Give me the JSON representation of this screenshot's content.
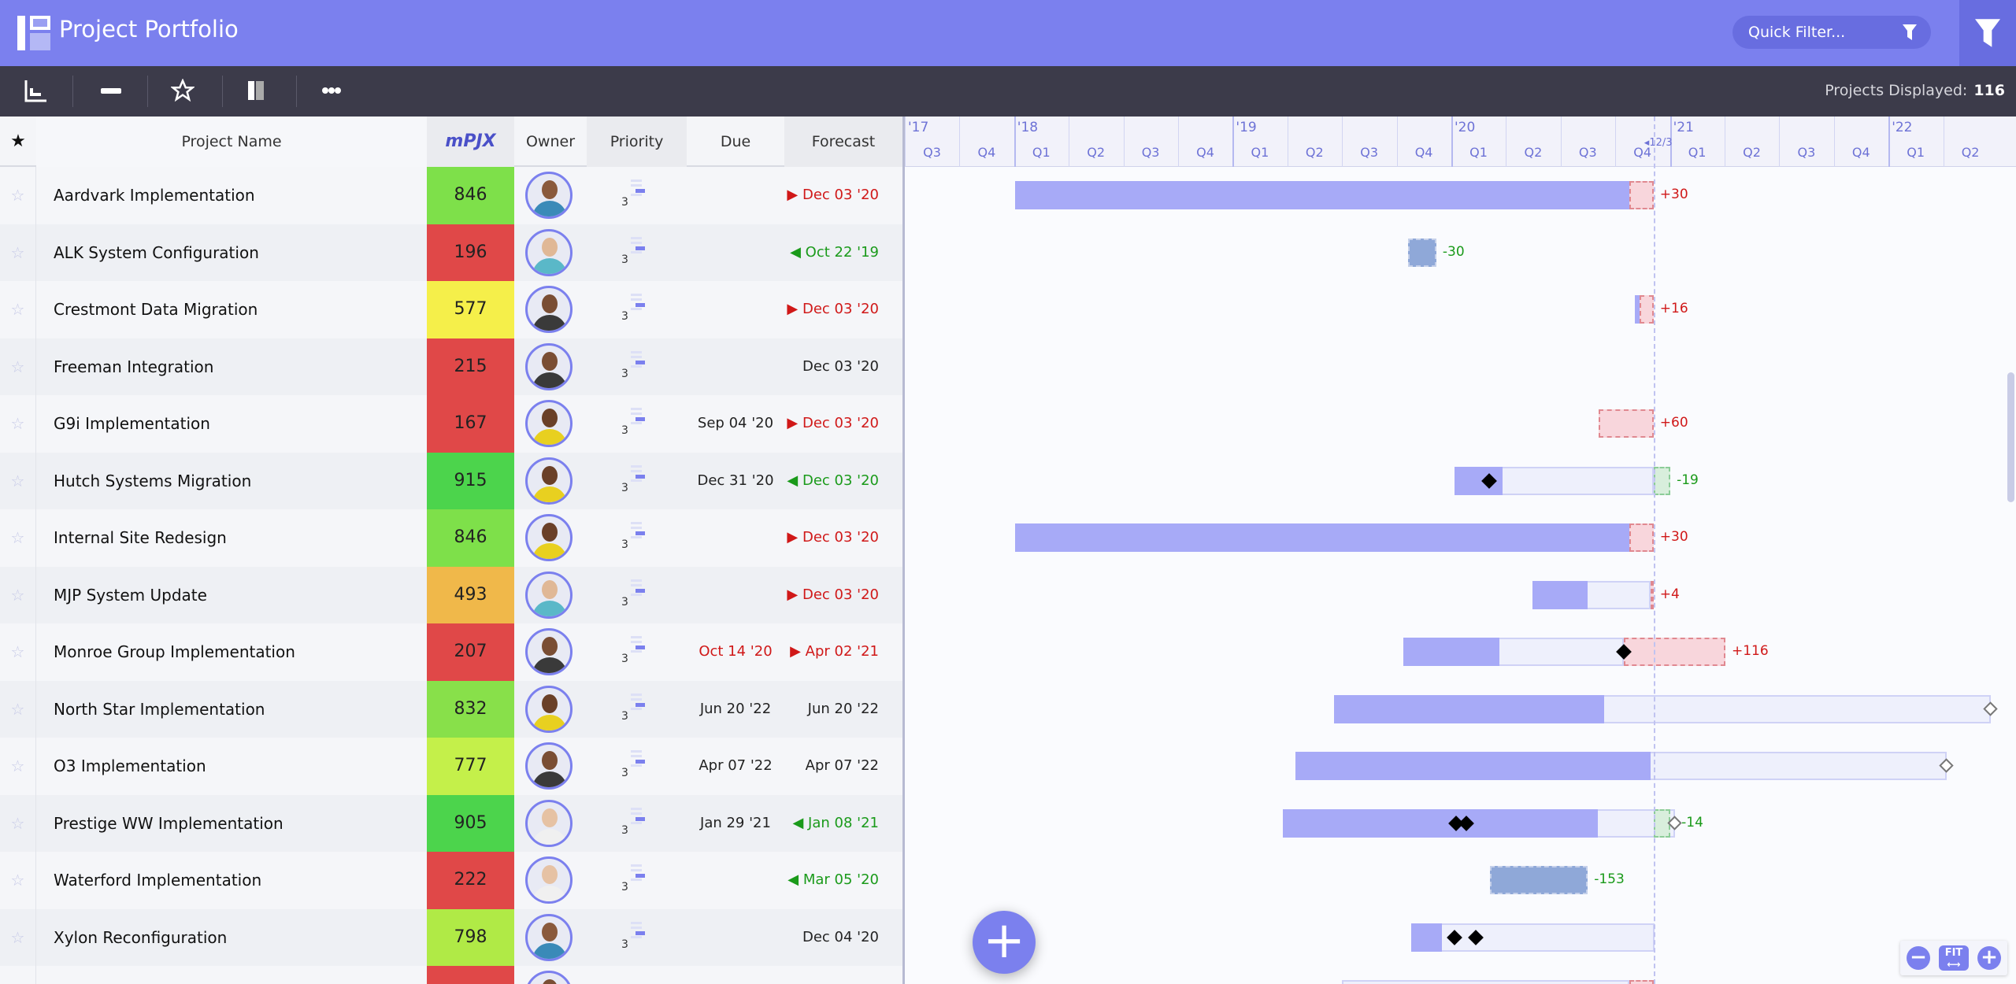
{
  "app": {
    "title": "Project Portfolio",
    "quick_filter_placeholder": "Quick Filter...",
    "accent": "#7b80ee"
  },
  "toolbar": {
    "icons": [
      "gantt-chart-icon",
      "collapse-icon",
      "favorite-star-icon",
      "column-layout-icon",
      "more-icon"
    ],
    "projects_displayed_label": "Projects Displayed:",
    "projects_displayed_value": "116"
  },
  "columns": {
    "star": "★",
    "name": "Project Name",
    "score": "mPJX",
    "owner": "Owner",
    "priority": "Priority",
    "due": "Due",
    "forecast": "Forecast"
  },
  "timeline": {
    "years": [
      "'17",
      "'18",
      "'19",
      "'20",
      "'21",
      "'22"
    ],
    "quarters": [
      "Q3",
      "Q4",
      "Q1",
      "Q2",
      "Q3",
      "Q4",
      "Q1",
      "Q2",
      "Q3",
      "Q4",
      "Q1",
      "Q2",
      "Q3",
      "Q4",
      "Q1",
      "Q2",
      "Q3",
      "Q4",
      "Q1",
      "Q2"
    ],
    "start": "2017-07-01",
    "today_label": "12/3",
    "today": "2020-12-03"
  },
  "rows": [
    {
      "name": "Aardvark Implementation",
      "score": "846",
      "score_color": "#7ee04a",
      "owner": "m1",
      "priority": "3",
      "due": "",
      "forecast": "Dec 03 '20",
      "forecast_status": "late",
      "gantt": {
        "outline": null,
        "fill": [
          "2018-01-01",
          "2020-10-24"
        ],
        "variance": [
          "2020-10-24",
          "2020-12-03"
        ],
        "variance_type": "over",
        "label": "+30",
        "milestones": [],
        "open_milestone": null
      }
    },
    {
      "name": "ALK System Configuration",
      "score": "196",
      "score_color": "#e04848",
      "owner": "w1",
      "priority": "3",
      "due": "",
      "forecast": "Oct 22 '19",
      "forecast_status": "early",
      "gantt": {
        "done": [
          "2019-10-20",
          "2019-12-06"
        ],
        "label": "-30",
        "variance_type": "under",
        "milestones": []
      }
    },
    {
      "name": "Crestmont Data Migration",
      "score": "577",
      "score_color": "#f5ef4a",
      "owner": "m2",
      "priority": "3",
      "due": "",
      "forecast": "Dec 03 '20",
      "forecast_status": "late",
      "gantt": {
        "fill": [
          "2020-11-02",
          "2020-11-10"
        ],
        "variance": [
          "2020-11-10",
          "2020-12-03"
        ],
        "variance_type": "over",
        "label": "+16",
        "milestones": []
      }
    },
    {
      "name": "Freeman Integration",
      "score": "215",
      "score_color": "#e04848",
      "owner": "m2",
      "priority": "3",
      "due": "",
      "forecast": "Dec 03 '20",
      "forecast_status": "none",
      "gantt": {
        "milestones": []
      }
    },
    {
      "name": "G9i Implementation",
      "score": "167",
      "score_color": "#e04848",
      "owner": "w2",
      "priority": "3",
      "due": "Sep 04 '20",
      "forecast": "Dec 03 '20",
      "forecast_status": "late",
      "gantt": {
        "variance": [
          "2020-09-02",
          "2020-12-03"
        ],
        "variance_type": "over",
        "label": "+60",
        "milestones": []
      }
    },
    {
      "name": "Hutch Systems Migration",
      "score": "915",
      "score_color": "#4cd44c",
      "owner": "w2",
      "priority": "3",
      "due": "Dec 31 '20",
      "forecast": "Dec 03 '20",
      "forecast_status": "early",
      "gantt": {
        "outline": [
          "2020-01-05",
          "2020-12-03"
        ],
        "fill": [
          "2020-01-05",
          "2020-03-25"
        ],
        "variance": [
          "2020-12-03",
          "2020-12-31"
        ],
        "variance_type": "under",
        "label": "-19",
        "milestones": [
          "2020-03-03"
        ]
      }
    },
    {
      "name": "Internal Site Redesign",
      "score": "846",
      "score_color": "#7ee04a",
      "owner": "w2",
      "priority": "3",
      "due": "",
      "forecast": "Dec 03 '20",
      "forecast_status": "late",
      "gantt": {
        "fill": [
          "2018-01-01",
          "2020-10-24"
        ],
        "variance": [
          "2020-10-24",
          "2020-12-03"
        ],
        "variance_type": "over",
        "label": "+30",
        "milestones": []
      }
    },
    {
      "name": "MJP System Update",
      "score": "493",
      "score_color": "#f0b84a",
      "owner": "w1",
      "priority": "3",
      "due": "",
      "forecast": "Dec 03 '20",
      "forecast_status": "late",
      "gantt": {
        "outline": [
          "2020-05-15",
          "2020-11-28"
        ],
        "fill": [
          "2020-05-15",
          "2020-08-15"
        ],
        "variance": [
          "2020-11-28",
          "2020-12-03"
        ],
        "variance_type": "over",
        "label": "+4",
        "milestones": []
      }
    },
    {
      "name": "Monroe Group Implementation",
      "score": "207",
      "score_color": "#e04848",
      "owner": "m2",
      "priority": "3",
      "due": "Oct 14 '20",
      "due_status": "late",
      "forecast": "Apr 02 '21",
      "forecast_status": "late",
      "gantt": {
        "outline": [
          "2019-10-12",
          "2020-10-14"
        ],
        "fill": [
          "2019-10-12",
          "2020-03-20"
        ],
        "variance": [
          "2020-10-14",
          "2021-04-02"
        ],
        "variance_type": "over",
        "label": "+116",
        "milestones": [
          "2020-10-14"
        ]
      }
    },
    {
      "name": "North Star Implementation",
      "score": "832",
      "score_color": "#88e04a",
      "owner": "w2",
      "priority": "3",
      "due": "Jun 20 '22",
      "forecast": "Jun 20 '22",
      "forecast_status": "none",
      "gantt": {
        "outline": [
          "2019-06-18",
          "2022-06-20"
        ],
        "fill": [
          "2019-06-18",
          "2020-09-12"
        ],
        "milestones": [],
        "open_milestone": "2022-06-20"
      }
    },
    {
      "name": "O3 Implementation",
      "score": "777",
      "score_color": "#c4f04a",
      "owner": "m2",
      "priority": "3",
      "due": "Apr 07 '22",
      "forecast": "Apr 07 '22",
      "forecast_status": "none",
      "gantt": {
        "outline": [
          "2019-04-15",
          "2022-04-07"
        ],
        "fill": [
          "2019-04-15",
          "2020-11-28"
        ],
        "milestones": [],
        "open_milestone": "2022-04-07"
      }
    },
    {
      "name": "Prestige WW Implementation",
      "score": "905",
      "score_color": "#4cd44c",
      "owner": "w3",
      "priority": "3",
      "due": "Jan 29 '21",
      "forecast": "Jan 08 '21",
      "forecast_status": "early",
      "gantt": {
        "outline": [
          "2019-03-25",
          "2021-01-08"
        ],
        "fill": [
          "2019-03-25",
          "2020-09-01"
        ],
        "variance": [
          "2020-12-03",
          "2020-12-31"
        ],
        "variance_type": "under",
        "label": "-14",
        "milestones": [
          "2020-01-08",
          "2020-01-25"
        ],
        "open_milestone": "2021-01-08"
      }
    },
    {
      "name": "Waterford Implementation",
      "score": "222",
      "score_color": "#e04848",
      "owner": "w3",
      "priority": "3",
      "due": "",
      "forecast": "Mar 05 '20",
      "forecast_status": "early",
      "gantt": {
        "done": [
          "2020-03-05",
          "2020-08-15"
        ],
        "label": "-153",
        "variance_type": "under",
        "milestones": []
      }
    },
    {
      "name": "Xylon Reconfiguration",
      "score": "798",
      "score_color": "#b0ea46",
      "owner": "m1",
      "priority": "3",
      "due": "",
      "forecast": "Dec 04 '20",
      "forecast_status": "none",
      "gantt": {
        "outline": [
          "2019-10-25",
          "2020-12-04"
        ],
        "fill": [
          "2019-10-25",
          "2019-12-15"
        ],
        "milestones": [
          "2020-01-05",
          "2020-02-10"
        ]
      }
    },
    {
      "name": "",
      "score": "",
      "score_color": "#e04848",
      "owner": "m2",
      "priority": "",
      "due": "",
      "forecast": "",
      "forecast_status": "none",
      "gantt": {
        "outline": [
          "2019-07-01",
          "2020-10-24"
        ],
        "variance": [
          "2020-10-24",
          "2020-12-03"
        ],
        "variance_type": "over",
        "milestones": []
      }
    }
  ],
  "owners": {
    "m1": {
      "skin": "#8a5a3c",
      "shirt": "#3a8ab8"
    },
    "m2": {
      "skin": "#7a4e34",
      "shirt": "#3a3a3a"
    },
    "w1": {
      "skin": "#e0b896",
      "shirt": "#5ab8c8"
    },
    "w2": {
      "skin": "#6a4028",
      "shirt": "#e8d020"
    },
    "w3": {
      "skin": "#e6c2a4",
      "shirt": "#f0f0f0"
    }
  },
  "zoom_controls": {
    "zoom_out": "−",
    "fit": "FIT",
    "zoom_in": "+"
  },
  "fab_label": "+"
}
